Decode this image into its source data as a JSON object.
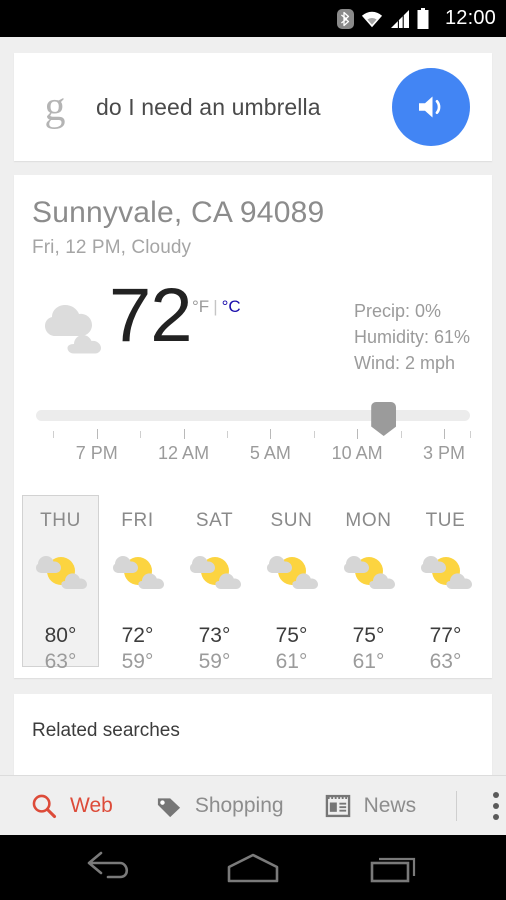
{
  "status_bar": {
    "clock": "12:00",
    "icons": [
      "bluetooth-icon",
      "wifi-icon",
      "signal-icon",
      "battery-icon"
    ]
  },
  "query_card": {
    "logo": "google-g-logo",
    "query": "do I need an umbrella",
    "speak_button": "speaker-icon",
    "accent_color": "#4285f4"
  },
  "weather": {
    "location": "Sunnyvale, CA 94089",
    "subtitle": "Fri, 12 PM, Cloudy",
    "condition_icon": "cloudy-icon",
    "temperature": "72",
    "unit_f": "°F",
    "unit_separator": "|",
    "unit_c": "°C",
    "unit_c_color": "#1a0dab",
    "details": [
      "Precip: 0%",
      "Humidity: 61%",
      "Wind: 2 mph"
    ],
    "slider": {
      "thumb_position_pct": 80,
      "labels": [
        "7 PM",
        "12 AM",
        "5 AM",
        "10 AM",
        "3 PM"
      ],
      "label_positions_pct": [
        14,
        34,
        54,
        74,
        94
      ]
    },
    "forecast": [
      {
        "day": "THU",
        "icon": "partly-cloudy-icon",
        "high": "80°",
        "low": "63°",
        "selected": true
      },
      {
        "day": "FRI",
        "icon": "partly-cloudy-icon",
        "high": "72°",
        "low": "59°",
        "selected": false
      },
      {
        "day": "SAT",
        "icon": "partly-cloudy-icon",
        "high": "73°",
        "low": "59°",
        "selected": false
      },
      {
        "day": "SUN",
        "icon": "partly-cloudy-icon",
        "high": "75°",
        "low": "61°",
        "selected": false
      },
      {
        "day": "MON",
        "icon": "partly-cloudy-icon",
        "high": "75°",
        "low": "61°",
        "selected": false
      },
      {
        "day": "TUE",
        "icon": "partly-cloudy-icon",
        "high": "77°",
        "low": "63°",
        "selected": false
      }
    ]
  },
  "related": {
    "title": "Related searches"
  },
  "tabbar": {
    "tabs": [
      {
        "label": "Web",
        "icon": "search-icon",
        "active": true
      },
      {
        "label": "Shopping",
        "icon": "tag-icon",
        "active": false
      },
      {
        "label": "News",
        "icon": "newspaper-icon",
        "active": false
      }
    ],
    "overflow": "more-options-icon",
    "active_color": "#dd4b39"
  },
  "navbar": {
    "buttons": [
      "back-icon",
      "home-icon",
      "recents-icon"
    ]
  }
}
